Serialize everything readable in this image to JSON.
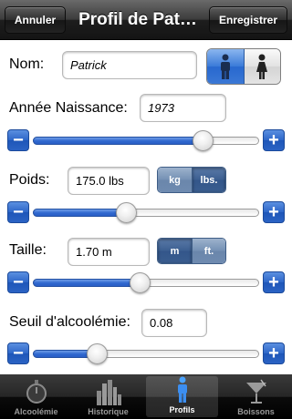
{
  "navbar": {
    "left_button": "Annuler",
    "title": "Profil de Pat…",
    "right_button": "Enregistrer"
  },
  "name": {
    "label": "Nom:",
    "value": "Patrick"
  },
  "gender": {
    "selected": "male",
    "options": [
      "male-icon",
      "female-icon"
    ]
  },
  "birth_year": {
    "label": "Année Naissance:",
    "value": "1973",
    "slider_fraction": 0.75
  },
  "weight": {
    "label": "Poids:",
    "value": "175.0 lbs",
    "units": [
      "kg",
      "lbs."
    ],
    "selected_unit": "lbs.",
    "slider_fraction": 0.41
  },
  "height": {
    "label": "Taille:",
    "value": "1.70 m",
    "units": [
      "m",
      "ft."
    ],
    "selected_unit": "m",
    "slider_fraction": 0.47
  },
  "alcohol_threshold": {
    "label": "Seuil d'alcoolémie:",
    "value": "0.08",
    "slider_fraction": 0.28
  },
  "stepper": {
    "minus": "−",
    "plus": "+"
  },
  "tabs": [
    {
      "label": "Alcoolémie",
      "icon": "stopwatch-icon"
    },
    {
      "label": "Historique",
      "icon": "bar-chart-icon"
    },
    {
      "label": "Profils",
      "icon": "person-icon",
      "active": true
    },
    {
      "label": "Boissons",
      "icon": "cocktail-glass-icon"
    }
  ],
  "colors": {
    "accent_blue": "#2d66c8",
    "segment_blue": "#3c5f91",
    "navbar": "#1e1e1e"
  }
}
